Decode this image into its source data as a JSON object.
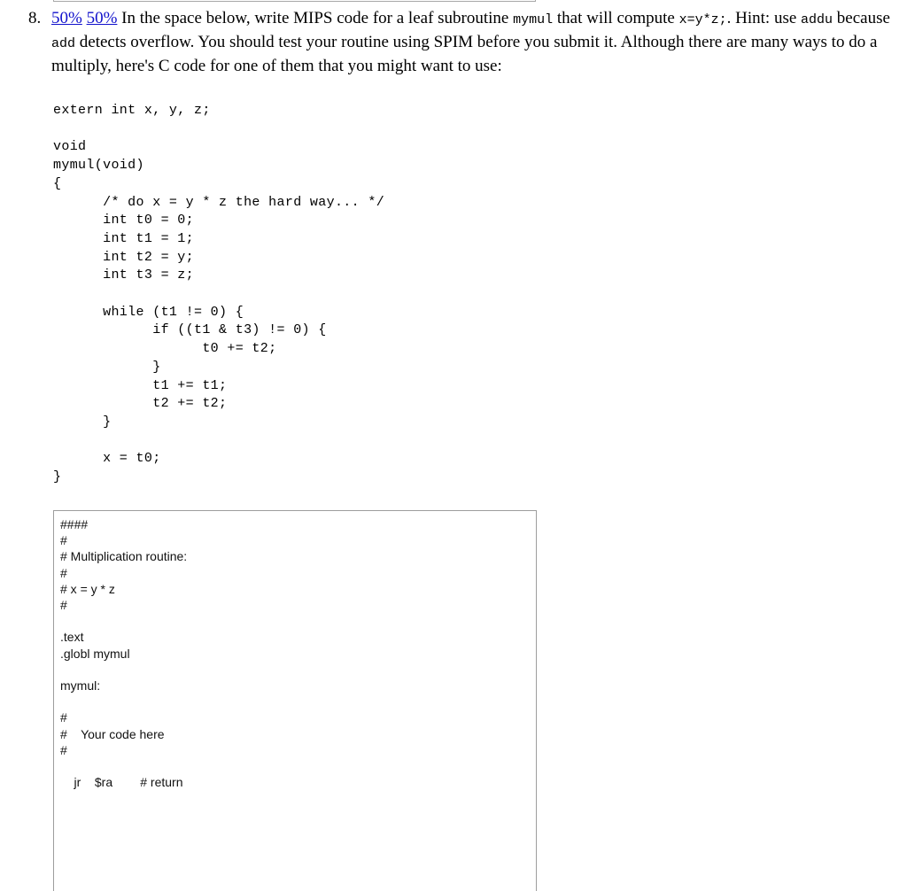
{
  "top_fragment": {
    "name": "previous-answer-textarea-bottom-edge"
  },
  "question": {
    "number": "8.",
    "links": [
      {
        "label": "50%"
      },
      {
        "label": "50%"
      }
    ],
    "text_part_1": "In the space below, write MIPS code for a leaf subroutine ",
    "code_1": "mymul",
    "text_part_2": " that will compute ",
    "code_2": "x=y*z;",
    "text_part_3": ". Hint: use ",
    "code_3": "addu",
    "text_part_4": " because ",
    "code_4": "add",
    "text_part_5": " detects overflow. You should test your routine using SPIM before you submit it. Although there are many ways to do a multiply, here's C code for one of them that you might want to use:"
  },
  "c_code": "extern int x, y, z;\n\nvoid\nmymul(void)\n{\n      /* do x = y * z the hard way... */\n      int t0 = 0;\n      int t1 = 1;\n      int t2 = y;\n      int t3 = z;\n\n      while (t1 != 0) {\n            if ((t1 & t3) != 0) {\n                  t0 += t2;\n            }\n            t1 += t1;\n            t2 += t2;\n      }\n\n      x = t0;\n}",
  "answer_box": {
    "value": "####\n#\n# Multiplication routine:\n#\n# x = y * z\n#\n\n.text\n.globl mymul\n\nmymul:\n\n#\n#    Your code here\n#\n\n    jr    $ra        # return",
    "placeholder": ""
  },
  "colors": {
    "link": "#1111cc",
    "border": "#9d9d9d",
    "text": "#000000",
    "background": "#ffffff"
  }
}
